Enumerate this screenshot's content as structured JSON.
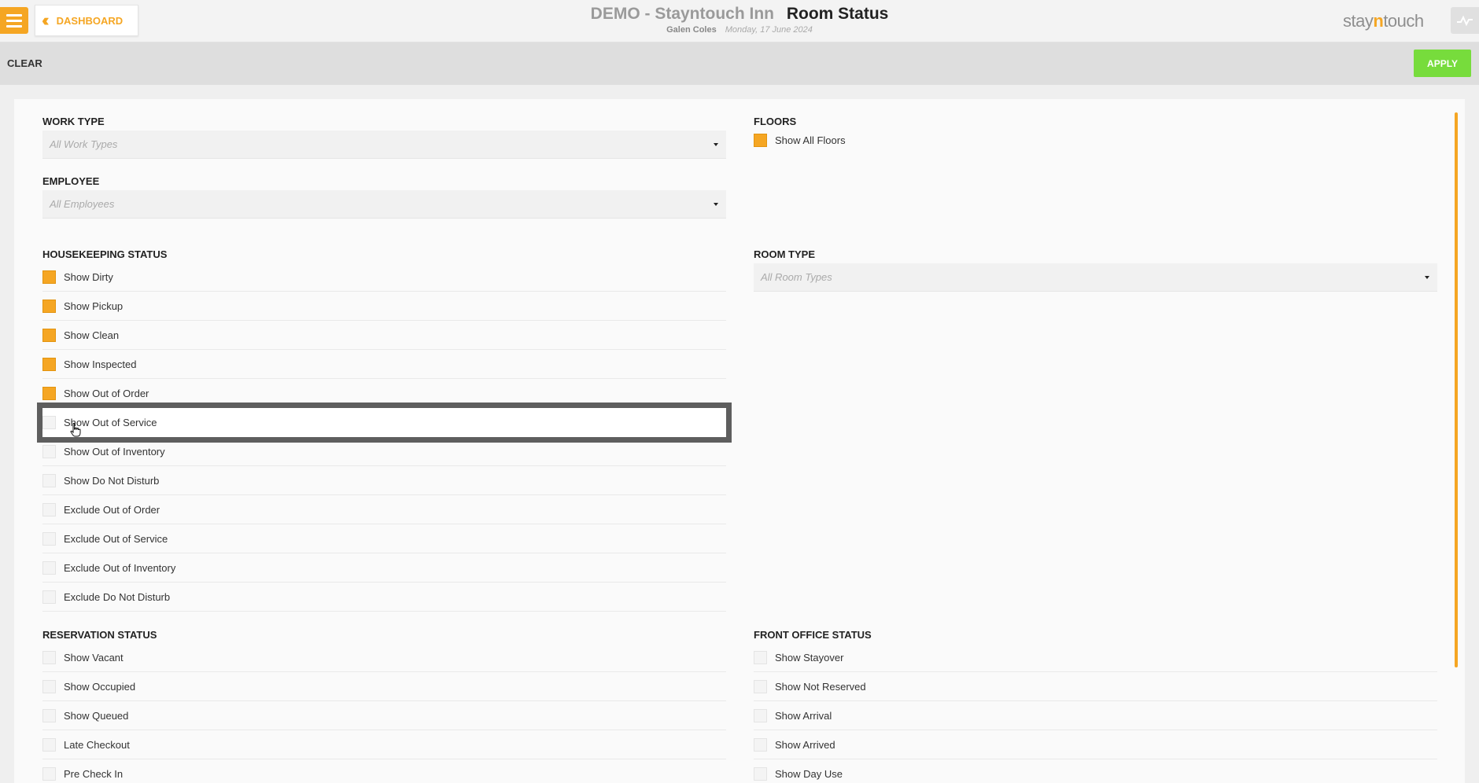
{
  "header": {
    "menu_icon": "hamburger-icon",
    "back_label": "DASHBOARD",
    "hotel_name": "DEMO - Stayntouch Inn",
    "page_title": "Room Status",
    "user_name": "Galen Coles",
    "date": "Monday, 17 June 2024",
    "brand_prefix": "stay",
    "brand_n": "n",
    "brand_suffix": "touch"
  },
  "actions": {
    "clear_label": "CLEAR",
    "apply_label": "APPLY"
  },
  "colors": {
    "accent": "#f5a623",
    "apply": "#77dc3c",
    "selection_frame": "#5e5e5e"
  },
  "filters": {
    "work_type": {
      "title": "WORK TYPE",
      "placeholder": "All Work Types"
    },
    "employee": {
      "title": "EMPLOYEE",
      "placeholder": "All Employees"
    },
    "floors": {
      "title": "FLOORS",
      "items": [
        {
          "label": "Show All Floors",
          "checked": true
        }
      ]
    },
    "room_type": {
      "title": "ROOM TYPE",
      "placeholder": "All Room Types"
    },
    "housekeeping": {
      "title": "HOUSEKEEPING STATUS",
      "items": [
        {
          "label": "Show Dirty",
          "checked": true
        },
        {
          "label": "Show Pickup",
          "checked": true
        },
        {
          "label": "Show Clean",
          "checked": true
        },
        {
          "label": "Show Inspected",
          "checked": true
        },
        {
          "label": "Show Out of Order",
          "checked": true
        },
        {
          "label": "Show Out of Service",
          "checked": false
        },
        {
          "label": "Show Out of Inventory",
          "checked": false
        },
        {
          "label": "Show Do Not Disturb",
          "checked": false
        },
        {
          "label": "Exclude Out of Order",
          "checked": false
        },
        {
          "label": "Exclude Out of Service",
          "checked": false
        },
        {
          "label": "Exclude Out of Inventory",
          "checked": false
        },
        {
          "label": "Exclude Do Not Disturb",
          "checked": false
        }
      ]
    },
    "reservation": {
      "title": "RESERVATION STATUS",
      "items": [
        {
          "label": "Show Vacant",
          "checked": false
        },
        {
          "label": "Show Occupied",
          "checked": false
        },
        {
          "label": "Show Queued",
          "checked": false
        },
        {
          "label": "Late Checkout",
          "checked": false
        },
        {
          "label": "Pre Check In",
          "checked": false
        }
      ]
    },
    "front_office": {
      "title": "FRONT OFFICE STATUS",
      "items": [
        {
          "label": "Show Stayover",
          "checked": false
        },
        {
          "label": "Show Not Reserved",
          "checked": false
        },
        {
          "label": "Show Arrival",
          "checked": false
        },
        {
          "label": "Show Arrived",
          "checked": false
        },
        {
          "label": "Show Day Use",
          "checked": false
        }
      ]
    }
  }
}
